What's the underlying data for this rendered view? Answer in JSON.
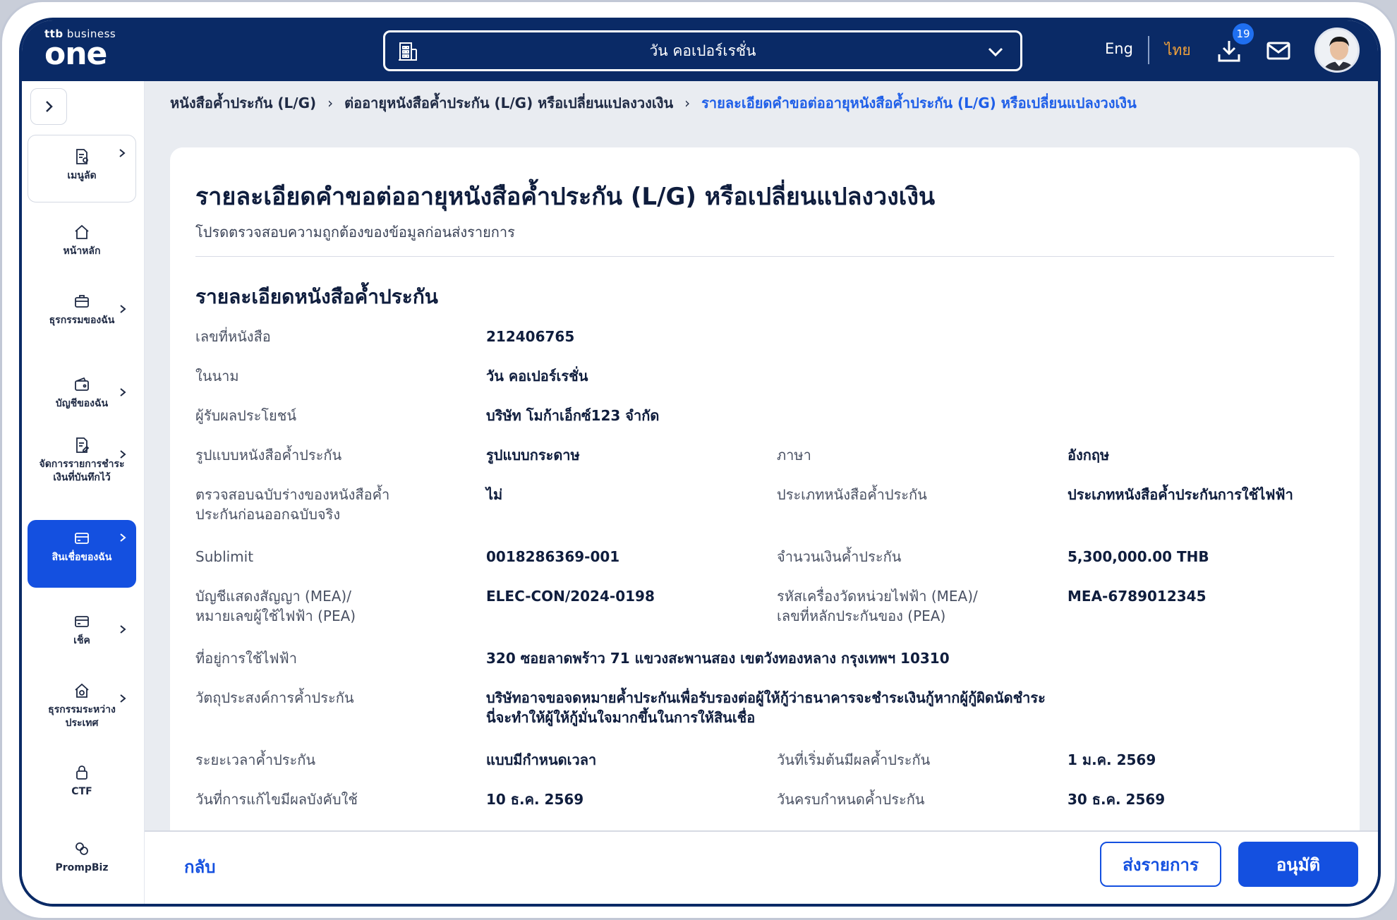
{
  "app": {
    "logo_top": "business",
    "logo_main": "one"
  },
  "header": {
    "company": "วัน คอเปอร์เรชั่น",
    "lang_en": "Eng",
    "lang_th": "ไทย",
    "download_count": "19",
    "accent": "#0a2a66",
    "active_lang_color": "#f2a23a"
  },
  "sidebar": {
    "items": [
      {
        "label": "เมนูลัด",
        "icon": "shortcut-doc-icon",
        "arrow": true
      },
      {
        "label": "หน้าหลัก",
        "icon": "home-icon",
        "arrow": false
      },
      {
        "label": "ธุรกรรมของฉัน",
        "icon": "briefcase-icon",
        "arrow": true
      },
      {
        "label": "บัญชีของฉัน",
        "icon": "wallet-icon",
        "arrow": true
      },
      {
        "label": "จัดการรายการชำระเงินที่บันทึกไว้",
        "icon": "doc-edit-icon",
        "arrow": true
      },
      {
        "label": "สินเชื่อของฉัน",
        "icon": "credit-card-icon",
        "arrow": true,
        "active": true
      },
      {
        "label": "เช็ค",
        "icon": "cheque-icon",
        "arrow": true
      },
      {
        "label": "ธุรกรรมระหว่างประเทศ",
        "icon": "globe-home-icon",
        "arrow": true
      },
      {
        "label": "CTF",
        "icon": "lock-icon",
        "arrow": false
      },
      {
        "label": "PrompBiz",
        "icon": "coins-icon",
        "arrow": false
      }
    ]
  },
  "breadcrumb": {
    "c1": "หนังสือค้ำประกัน (L/G)",
    "c2": "ต่ออายุหนังสือค้ำประกัน (L/G) หรือเปลี่ยนแปลงวงเงิน",
    "c3": "รายละเอียดคำขอต่ออายุหนังสือค้ำประกัน (L/G) หรือเปลี่ยนแปลงวงเงิน"
  },
  "page": {
    "title": "รายละเอียดคำขอต่ออายุหนังสือค้ำประกัน (L/G) หรือเปลี่ยนแปลงวงเงิน",
    "subtitle": "โปรดตรวจสอบความถูกต้องของข้อมูลก่อนส่งรายการ",
    "section": "รายละเอียดหนังสือค้ำประกัน"
  },
  "details": {
    "lg_no_label": "เลขที่หนังสือ",
    "lg_no": "212406765",
    "on_behalf_label": "ในนาม",
    "on_behalf": "วัน คอเปอร์เรชั่น",
    "beneficiary_label": "ผู้รับผลประโยชน์",
    "beneficiary": "บริษัท โมก้าเอ็กซ์123 จำกัด",
    "format_label": "รูปแบบหนังสือค้ำประกัน",
    "format": "รูปแบบกระดาษ",
    "language_label": "ภาษา",
    "language": "อังกฤษ",
    "draft_check_label_1": "ตรวจสอบฉบับร่างของหนังสือค้ำ",
    "draft_check_label_2": "ประกันก่อนออกฉบับจริง",
    "draft_check": "ไม่",
    "lg_type_label": "ประเภทหนังสือค้ำประกัน",
    "lg_type": "ประเภทหนังสือค้ำประกันการใช้ไฟฟ้า",
    "sublimit_label": "Sublimit",
    "sublimit": "0018286369-001",
    "amount_label": "จำนวนเงินค้ำประกัน",
    "amount": "5,300,000.00 THB",
    "contract_label_1": "บัญชีแสดงสัญญา (MEA)/",
    "contract_label_2": "หมายเลขผู้ใช้ไฟฟ้า (PEA)",
    "contract": "ELEC-CON/2024-0198",
    "meter_label_1": "รหัสเครื่องวัดหน่วยไฟฟ้า (MEA)/",
    "meter_label_2": "เลขที่หลักประกันของ (PEA)",
    "meter": "MEA-6789012345",
    "address_label": "ที่อยู่การใช้ไฟฟ้า",
    "address": "320 ซอยลาดพร้าว 71 แขวงสะพานสอง เขตวังทองหลาง กรุงเทพฯ 10310",
    "purpose_label": "วัตถุประสงค์การค้ำประกัน",
    "purpose_1": "บริษัทอาจขอจดหมายค้ำประกันเพื่อรับรองต่อผู้ให้กู้ว่าธนาคารจะชำระเงินกู้หากผู้กู้ผิดนัดชำระ",
    "purpose_2": "นี่จะทำให้ผู้ให้กู้มั่นใจมากขึ้นในการให้สินเชื่อ",
    "period_label": "ระยะเวลาค้ำประกัน",
    "period": "แบบมีกำหนดเวลา",
    "start_label": "วันที่เริ่มต้นมีผลค้ำประกัน",
    "start": "1 ม.ค. 2569",
    "amend_label": "วันที่การแก้ไขมีผลบังคับใช้",
    "amend": "10 ธ.ค. 2569",
    "end_label": "วันครบกำหนดค้ำประกัน",
    "end": "30 ธ.ค. 2569"
  },
  "footer": {
    "back": "กลับ",
    "submit": "ส่งรายการ",
    "approve": "อนุมัติ",
    "primary_color": "#1450e0"
  }
}
